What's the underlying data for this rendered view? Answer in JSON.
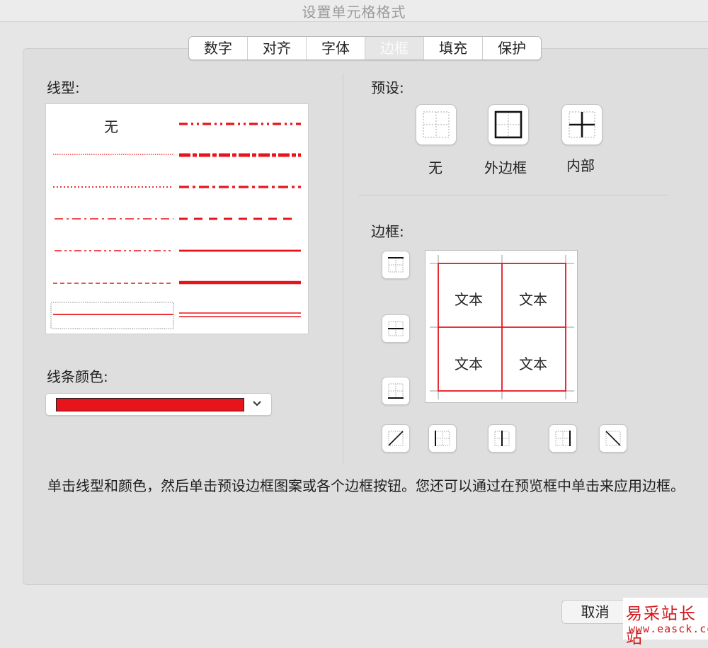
{
  "window": {
    "title": "设置单元格格式"
  },
  "tabs": [
    {
      "label": "数字",
      "active": false
    },
    {
      "label": "对齐",
      "active": false
    },
    {
      "label": "字体",
      "active": false
    },
    {
      "label": "边框",
      "active": true
    },
    {
      "label": "填充",
      "active": false
    },
    {
      "label": "保护",
      "active": false
    }
  ],
  "line_style": {
    "label": "线型:",
    "none_label": "无",
    "left_column": [
      "dotted-fine",
      "dotted",
      "dash-dot",
      "dash-dot-dot",
      "dashed-fine",
      "thin-selected"
    ],
    "right_column": [
      "dash-dot-dot-medium",
      "slanted-dash-dot",
      "dash-dot-medium",
      "dashed-medium",
      "medium",
      "thick",
      "double"
    ]
  },
  "line_color": {
    "label": "线条颜色:",
    "value": "#e8141c"
  },
  "presets": {
    "label": "预设:",
    "items": [
      {
        "label": "无",
        "icon": "border-none-icon"
      },
      {
        "label": "外边框",
        "icon": "border-outline-icon"
      },
      {
        "label": "内部",
        "icon": "border-inside-icon"
      }
    ]
  },
  "border": {
    "label": "边框:",
    "preview_cells": [
      "文本",
      "文本",
      "文本",
      "文本"
    ],
    "buttons": [
      "border-top-icon",
      "border-inside-horizontal-icon",
      "border-bottom-icon",
      "diagonal-up-icon",
      "border-left-icon",
      "border-inside-vertical-icon",
      "border-right-icon",
      "diagonal-down-icon"
    ]
  },
  "help_text": "单击线型和颜色，然后单击预设边框图案或各个边框按钮。您还可以通过在预览框中单击来应用边框。",
  "buttons": {
    "cancel": "取消"
  },
  "watermark": {
    "name": "易采站长站",
    "url": "www.easck.com"
  },
  "colors": {
    "accent": "#e8141c",
    "panel": "#dedede",
    "background": "#e6e6e6"
  }
}
